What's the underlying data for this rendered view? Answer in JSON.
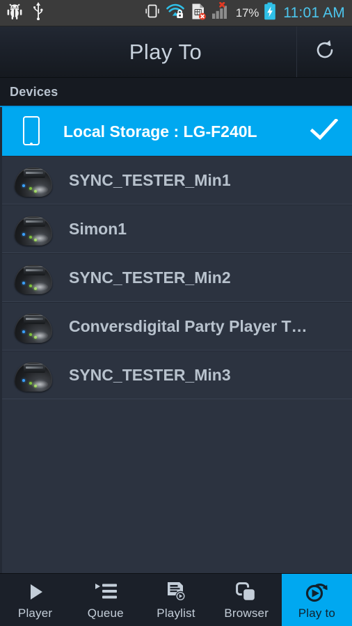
{
  "status_bar": {
    "battery_percent": "17%",
    "clock": "11:01 AM",
    "icons": [
      "android-debug-bug-icon",
      "usb-icon",
      "vibrate-phone-icon",
      "wifi-secured-icon",
      "sim-card-error-icon",
      "signal-bars-error-icon",
      "battery-charging-icon"
    ]
  },
  "titlebar": {
    "title": "Play To",
    "refresh_icon": "refresh-icon"
  },
  "section": {
    "header": "Devices"
  },
  "devices": [
    {
      "label": "Local Storage : LG-F240L",
      "icon": "phone-device-icon",
      "selected": true,
      "check_icon": "checkmark-icon"
    },
    {
      "label": "SYNC_TESTER_Min1",
      "icon": "media-renderer-icon",
      "selected": false
    },
    {
      "label": "Simon1",
      "icon": "media-renderer-icon",
      "selected": false
    },
    {
      "label": "SYNC_TESTER_Min2",
      "icon": "media-renderer-icon",
      "selected": false
    },
    {
      "label": "Conversdigital Party Player T…",
      "icon": "media-renderer-icon",
      "selected": false
    },
    {
      "label": "SYNC_TESTER_Min3",
      "icon": "media-renderer-icon",
      "selected": false
    }
  ],
  "tabs": [
    {
      "label": "Player",
      "icon": "play-triangle-icon",
      "active": false
    },
    {
      "label": "Queue",
      "icon": "queue-list-icon",
      "active": false
    },
    {
      "label": "Playlist",
      "icon": "playlist-document-icon",
      "active": false
    },
    {
      "label": "Browser",
      "icon": "browser-windows-icon",
      "active": false
    },
    {
      "label": "Play to",
      "icon": "play-to-cast-icon",
      "active": true
    }
  ],
  "colors": {
    "accent": "#00a8f0",
    "list_background": "#2c3340",
    "titlebar_background": "#1b2029",
    "section_background": "#161a21",
    "status_bar_background": "#3b3b3b",
    "clock_color": "#4cc6ee",
    "primary_text": "#b8c2cd"
  }
}
